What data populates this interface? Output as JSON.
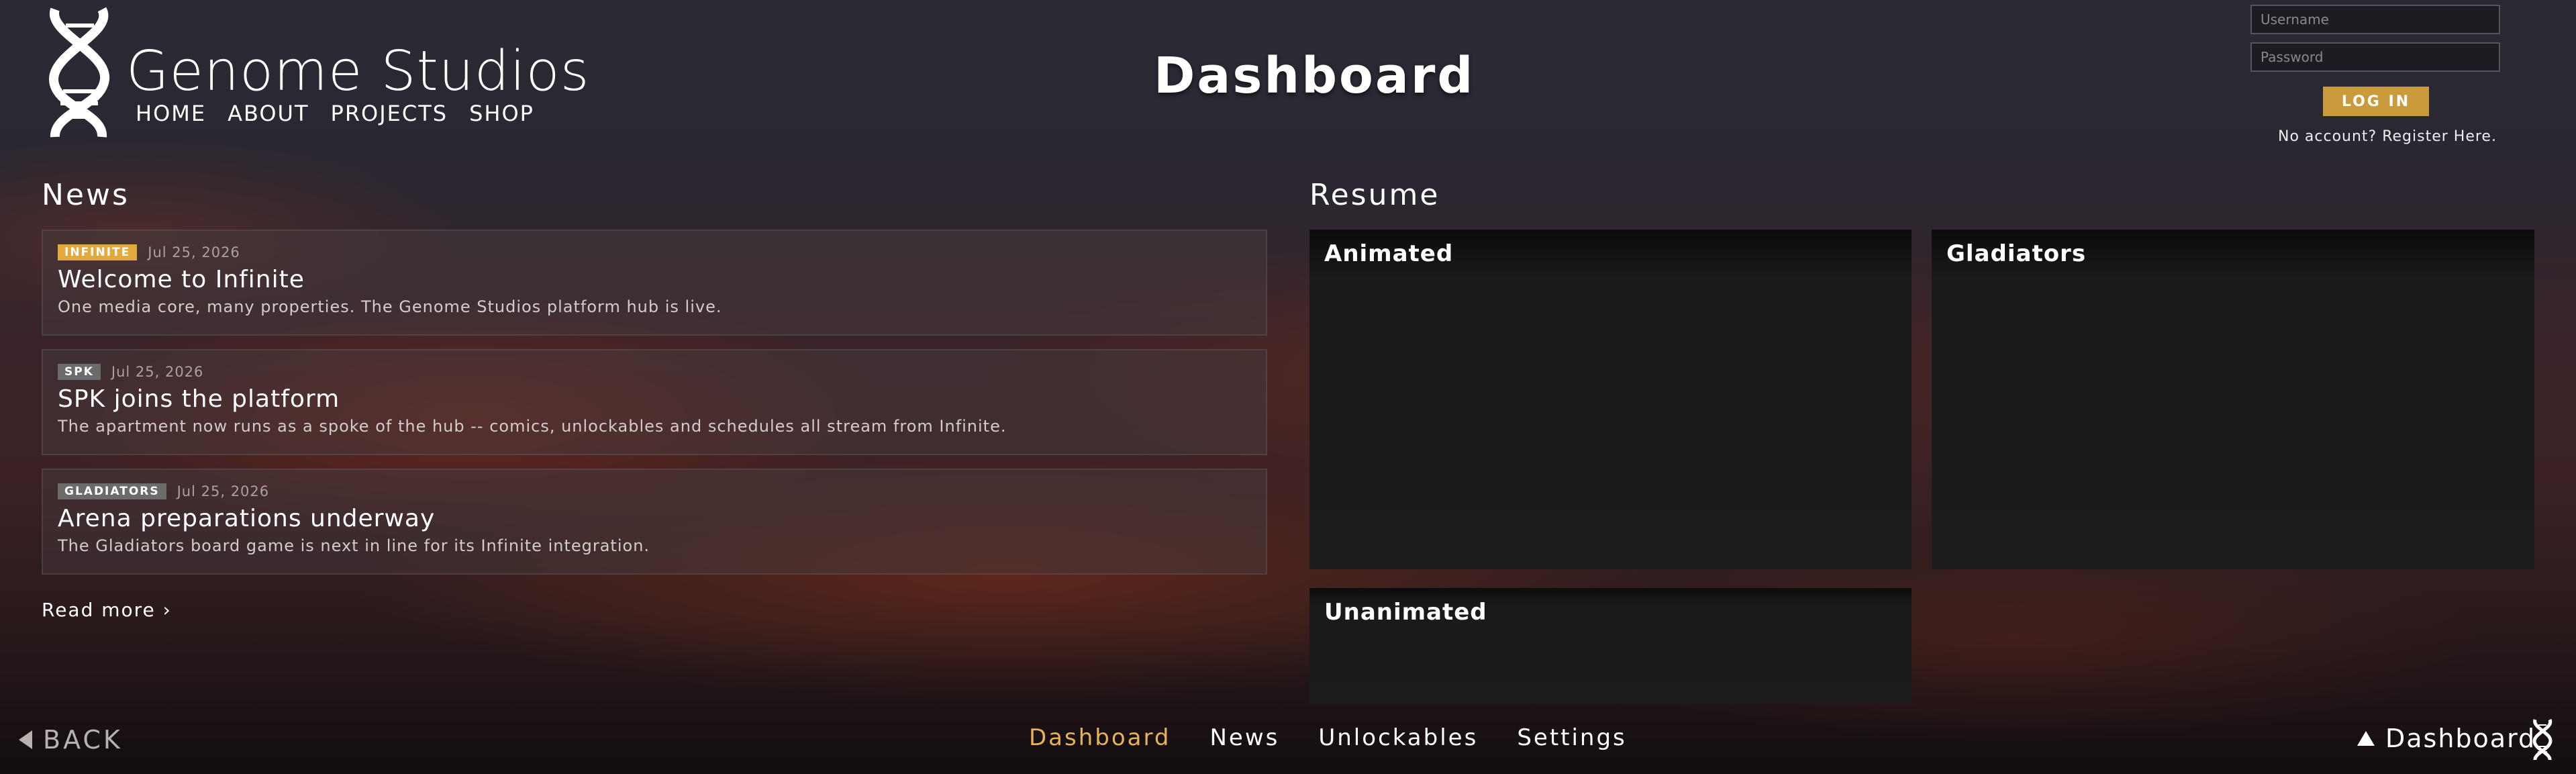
{
  "header": {
    "brand": "Genome Studios",
    "nav": [
      "HOME",
      "ABOUT",
      "PROJECTS",
      "SHOP"
    ],
    "page_title": "Dashboard"
  },
  "login": {
    "username_placeholder": "Username",
    "password_placeholder": "Password",
    "login_label": "LOG IN",
    "register_text": "No account? Register Here."
  },
  "news": {
    "heading": "News",
    "items": [
      {
        "tag": "INFINITE",
        "date": "Jul 25, 2026",
        "title": "Welcome to Infinite",
        "desc": "One media core, many properties. The Genome Studios platform hub is live."
      },
      {
        "tag": "SPK",
        "date": "Jul 25, 2026",
        "title": "SPK joins the platform",
        "desc": "The apartment now runs as a spoke of the hub -- comics, unlockables and schedules all stream from Infinite."
      },
      {
        "tag": "GLADIATORS",
        "date": "Jul 25, 2026",
        "title": "Arena preparations underway",
        "desc": "The Gladiators board game is next in line for its Infinite integration."
      }
    ],
    "read_more": "Read more ›"
  },
  "resume": {
    "heading": "Resume",
    "panels": [
      "Animated",
      "Gladiators",
      "Unanimated"
    ]
  },
  "footer": {
    "back": "BACK",
    "tabs": [
      "Dashboard",
      "News",
      "Unlockables",
      "Settings"
    ],
    "active_tab": "Dashboard",
    "current": "Dashboard"
  },
  "colors": {
    "accent_gold": "#e7b25a",
    "button_gold": "#c99b3d",
    "badge_gold": "#e2aa3e",
    "badge_gray": "#6b6b6b"
  },
  "icons": [
    "dna-logo-icon",
    "back-triangle-icon",
    "up-triangle-icon",
    "dna-small-icon"
  ]
}
